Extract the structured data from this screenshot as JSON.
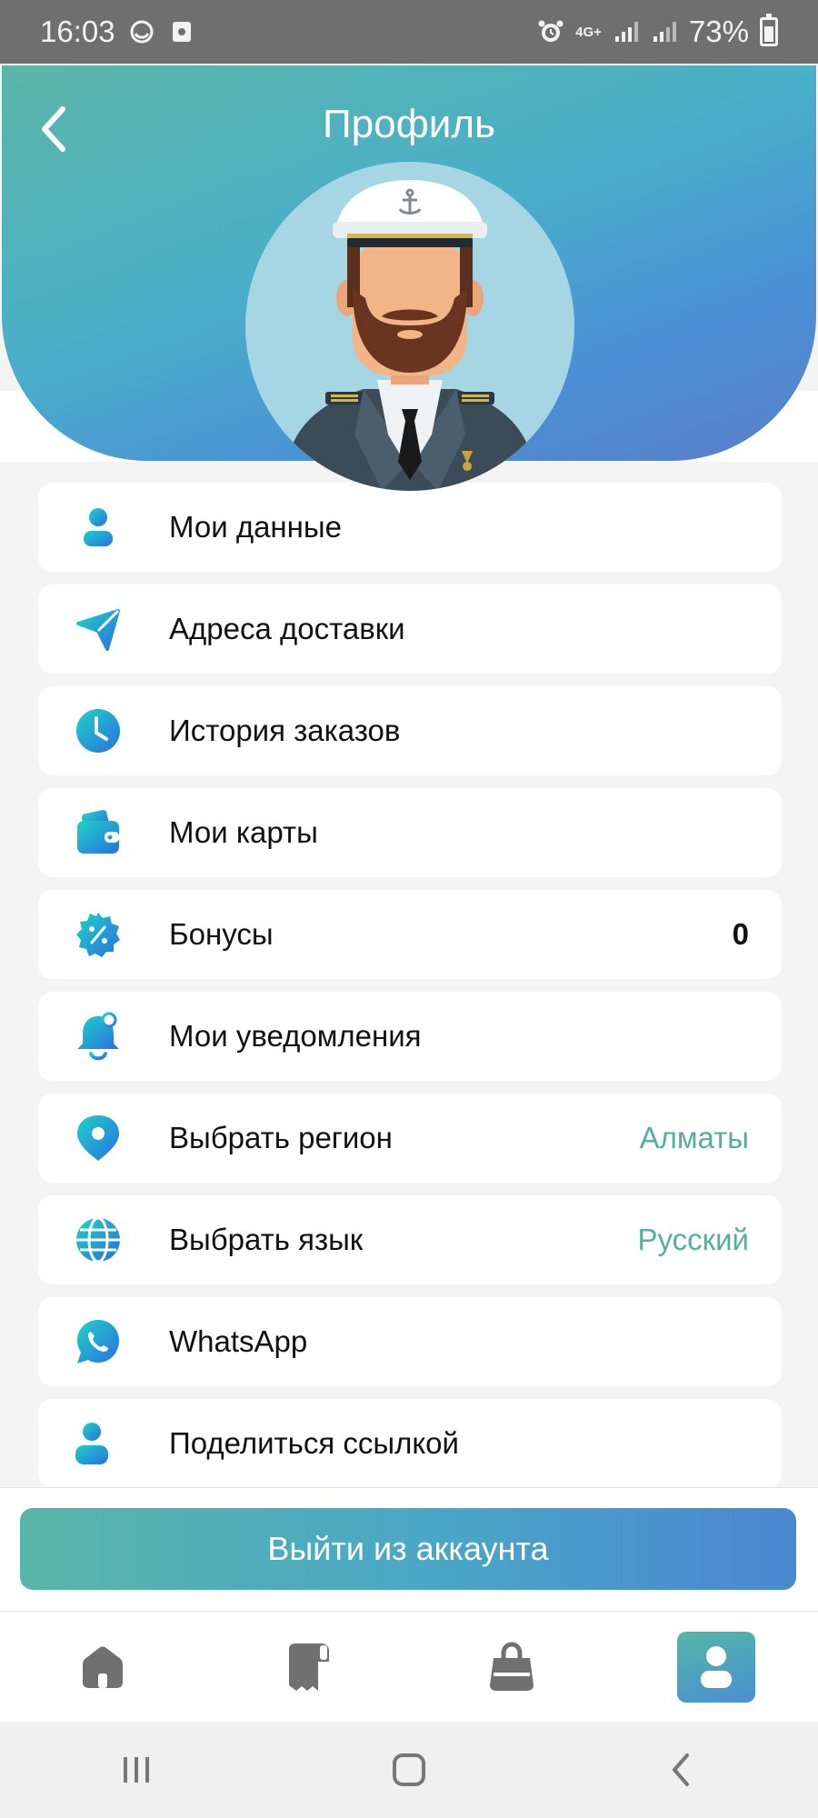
{
  "status_bar": {
    "time": "16:03",
    "network": "4G+",
    "battery": "73%"
  },
  "header": {
    "title": "Профиль"
  },
  "menu": {
    "items": [
      {
        "label": "Мои данные",
        "value": "",
        "icon": "user-icon"
      },
      {
        "label": "Адреса доставки",
        "value": "",
        "icon": "location-arrow-icon"
      },
      {
        "label": "История заказов",
        "value": "",
        "icon": "clock-icon"
      },
      {
        "label": "Мои карты",
        "value": "",
        "icon": "wallet-icon"
      },
      {
        "label": "Бонусы",
        "value": "0",
        "icon": "discount-badge-icon"
      },
      {
        "label": "Мои уведомления",
        "value": "",
        "icon": "bell-icon"
      },
      {
        "label": "Выбрать регион",
        "value": "Алматы",
        "icon": "map-pin-icon"
      },
      {
        "label": "Выбрать язык",
        "value": "Русский",
        "icon": "globe-icon"
      },
      {
        "label": "WhatsApp",
        "value": "",
        "icon": "whatsapp-icon"
      },
      {
        "label": "Поделиться ссылкой",
        "value": "",
        "icon": "add-user-icon"
      }
    ]
  },
  "logout": {
    "label": "Выйти из аккаунта"
  },
  "tab_bar": {
    "tabs": [
      {
        "icon": "home-icon",
        "active": false
      },
      {
        "icon": "receipt-icon",
        "active": false
      },
      {
        "icon": "shopping-bag-icon",
        "active": false
      },
      {
        "icon": "profile-icon",
        "active": true
      }
    ]
  },
  "colors": {
    "accent": "#57ad9e",
    "gradient_start": "#58b6a8",
    "gradient_end": "#4b87d2",
    "icon_start": "#1fd1c8",
    "icon_end": "#2b6fe0"
  }
}
